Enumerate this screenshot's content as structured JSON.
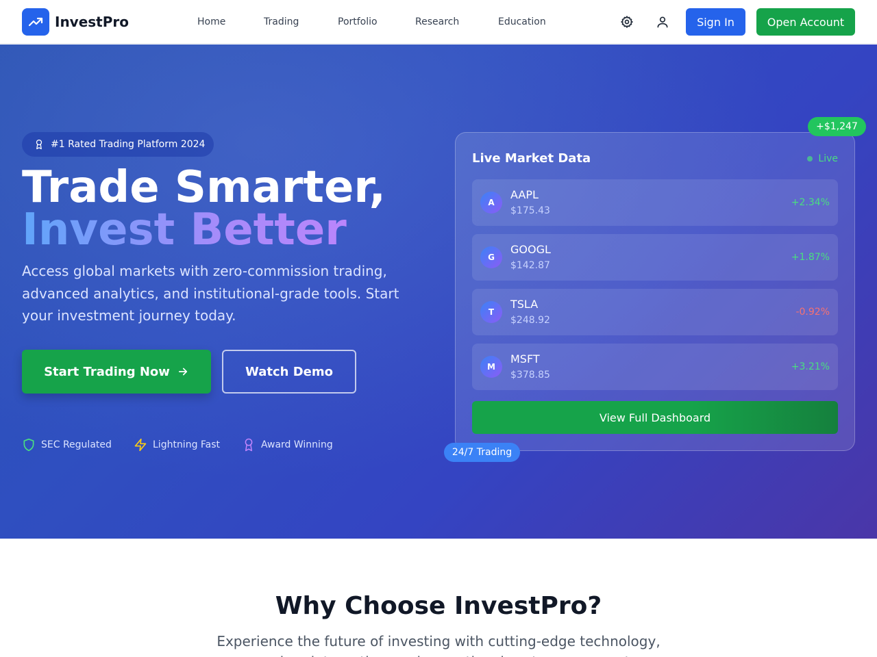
{
  "nav": {
    "brand": "InvestPro",
    "links": [
      "Home",
      "Trading",
      "Portfolio",
      "Research",
      "Education"
    ],
    "icons": [
      "gear-icon",
      "user-icon"
    ],
    "sign_in": "Sign In",
    "open_account": "Open Account"
  },
  "hero": {
    "badge": "#1 Rated Trading Platform 2024",
    "title_line1": "Trade Smarter,",
    "title_line2": "Invest Better",
    "lead": "Access global markets with zero-commission trading, advanced analytics, and institutional-grade tools. Start your investment journey today.",
    "cta_primary": "Start Trading Now",
    "cta_secondary": "Watch Demo",
    "features": [
      {
        "label": "SEC Regulated",
        "icon": "shield-icon"
      },
      {
        "label": "Lightning Fast",
        "icon": "lightning-icon"
      },
      {
        "label": "Award Winning",
        "icon": "award-icon"
      }
    ]
  },
  "market": {
    "title": "Live Market Data",
    "status": "Live",
    "stocks": [
      {
        "initial": "A",
        "symbol": "AAPL",
        "price": "$175.43",
        "change": "+2.34%",
        "direction": "up"
      },
      {
        "initial": "G",
        "symbol": "GOOGL",
        "price": "$142.87",
        "change": "+1.87%",
        "direction": "up"
      },
      {
        "initial": "T",
        "symbol": "TSLA",
        "price": "$248.92",
        "change": "-0.92%",
        "direction": "down"
      },
      {
        "initial": "M",
        "symbol": "MSFT",
        "price": "$378.85",
        "change": "+3.21%",
        "direction": "up"
      }
    ],
    "dashboard_button": "View Full Dashboard",
    "gain_pill": "+$1,247",
    "trading_pill": "24/7 Trading"
  },
  "why": {
    "title": "Why Choose InvestPro?",
    "subtitle": "Experience the future of investing with cutting-edge technology, seamless integration, and exceptional customer support."
  },
  "colors": {
    "primary": "#2563eb",
    "success": "#16a34a",
    "up": "#4ade80",
    "down": "#f87171"
  }
}
